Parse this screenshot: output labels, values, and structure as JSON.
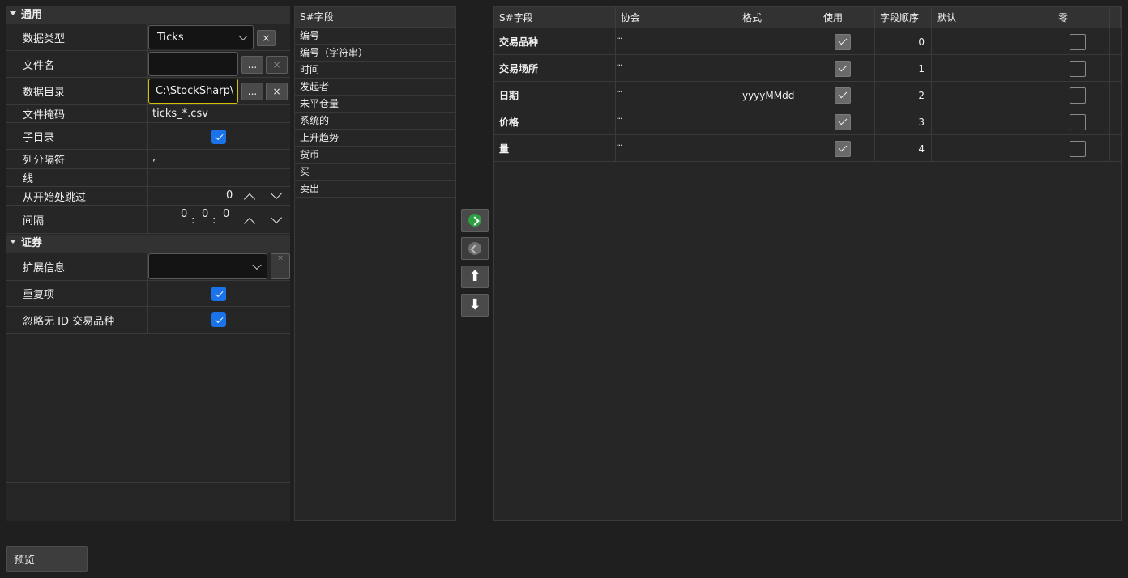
{
  "props": {
    "section_general": "通用",
    "data_type_label": "数据类型",
    "data_type_value": "Ticks",
    "file_name_label": "文件名",
    "file_name_value": "",
    "data_dir_label": "数据目录",
    "data_dir_value": "C:\\StockSharp\\",
    "file_mask_label": "文件掩码",
    "file_mask_value": "ticks_*.csv",
    "subdir_label": "子目录",
    "col_sep_label": "列分隔符",
    "col_sep_value": ",",
    "line_label": "线",
    "skip_label": "从开始处跳过",
    "skip_value": "0",
    "interval_label": "间隔",
    "interval_h": "0",
    "interval_m": "0",
    "interval_s": "0",
    "interval_colon": ":",
    "section_security": "证券",
    "ext_info_label": "扩展信息",
    "dup_label": "重复项",
    "ignore_label": "忽略无 ID 交易品种",
    "browse_label": "...",
    "clear_label": "×"
  },
  "field_list": {
    "header": "S#字段",
    "items": [
      "编号",
      "编号（字符串）",
      "时间",
      "发起者",
      "未平仓量",
      "系统的",
      "上升趋势",
      "货币",
      "买",
      "卖出"
    ]
  },
  "table": {
    "headers": [
      "S#字段",
      "协会",
      "格式",
      "使用",
      "字段顺序",
      "默认",
      "零"
    ],
    "rows": [
      {
        "field": "交易品种",
        "assoc": "...",
        "format": "",
        "order": "0"
      },
      {
        "field": "交易场所",
        "assoc": "...",
        "format": "",
        "order": "1"
      },
      {
        "field": "日期",
        "assoc": "...",
        "format": "yyyyMMdd",
        "order": "2"
      },
      {
        "field": "价格",
        "assoc": "...",
        "format": "",
        "order": "3"
      },
      {
        "field": "量",
        "assoc": "...",
        "format": "",
        "order": "4"
      }
    ]
  },
  "preview_label": "预览",
  "colors": {
    "accent": "#1a73e8",
    "add_green": "#2ea043",
    "focus_yellow": "#d4c200"
  }
}
